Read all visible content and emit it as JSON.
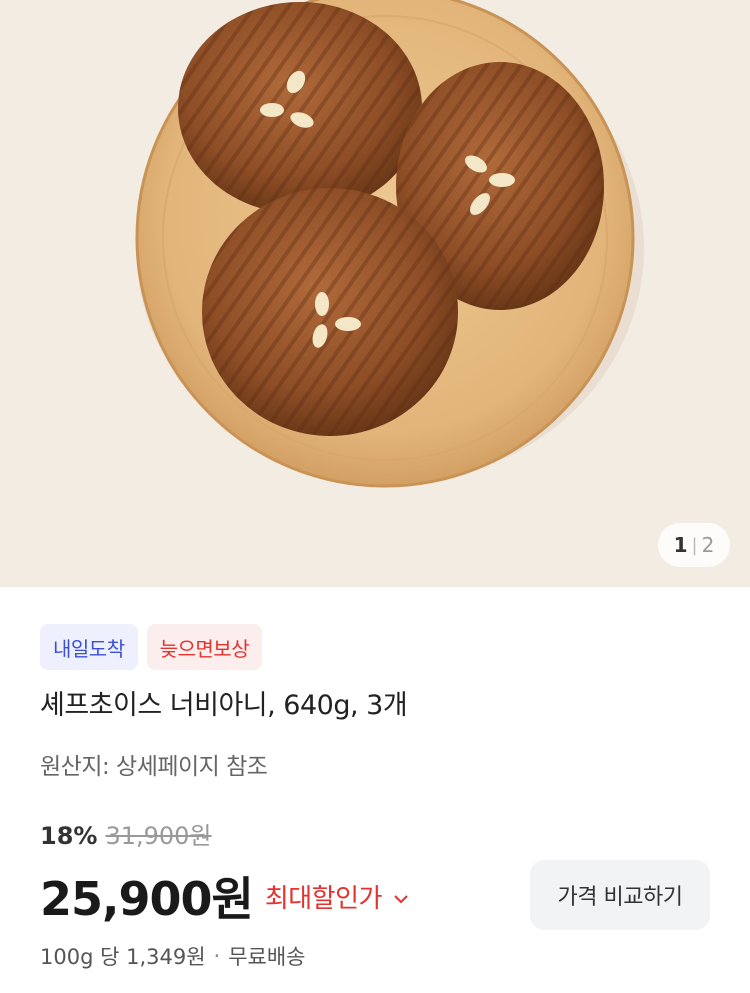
{
  "gallery": {
    "current_page": "1",
    "separator": "|",
    "total_pages": "2"
  },
  "badges": {
    "delivery": "내일도착",
    "late_compensation": "늦으면보상"
  },
  "product": {
    "title": "셰프초이스 너비아니, 640g, 3개",
    "origin": "원산지: 상세페이지 참조"
  },
  "pricing": {
    "discount_rate": "18%",
    "original_price": "31,900원",
    "sale_price": "25,900원",
    "max_discount_label": "최대할인가",
    "compare_button": "가격 비교하기",
    "unit_price": "100g 당 1,349원",
    "separator_dot": "·",
    "shipping": "무료배송"
  },
  "colors": {
    "accent_red": "#e4322f",
    "badge_blue": "#3b4fd8",
    "hero_bg": "#f3ece3"
  },
  "icons": {
    "max_discount_chevron": "chevron-down-icon"
  }
}
